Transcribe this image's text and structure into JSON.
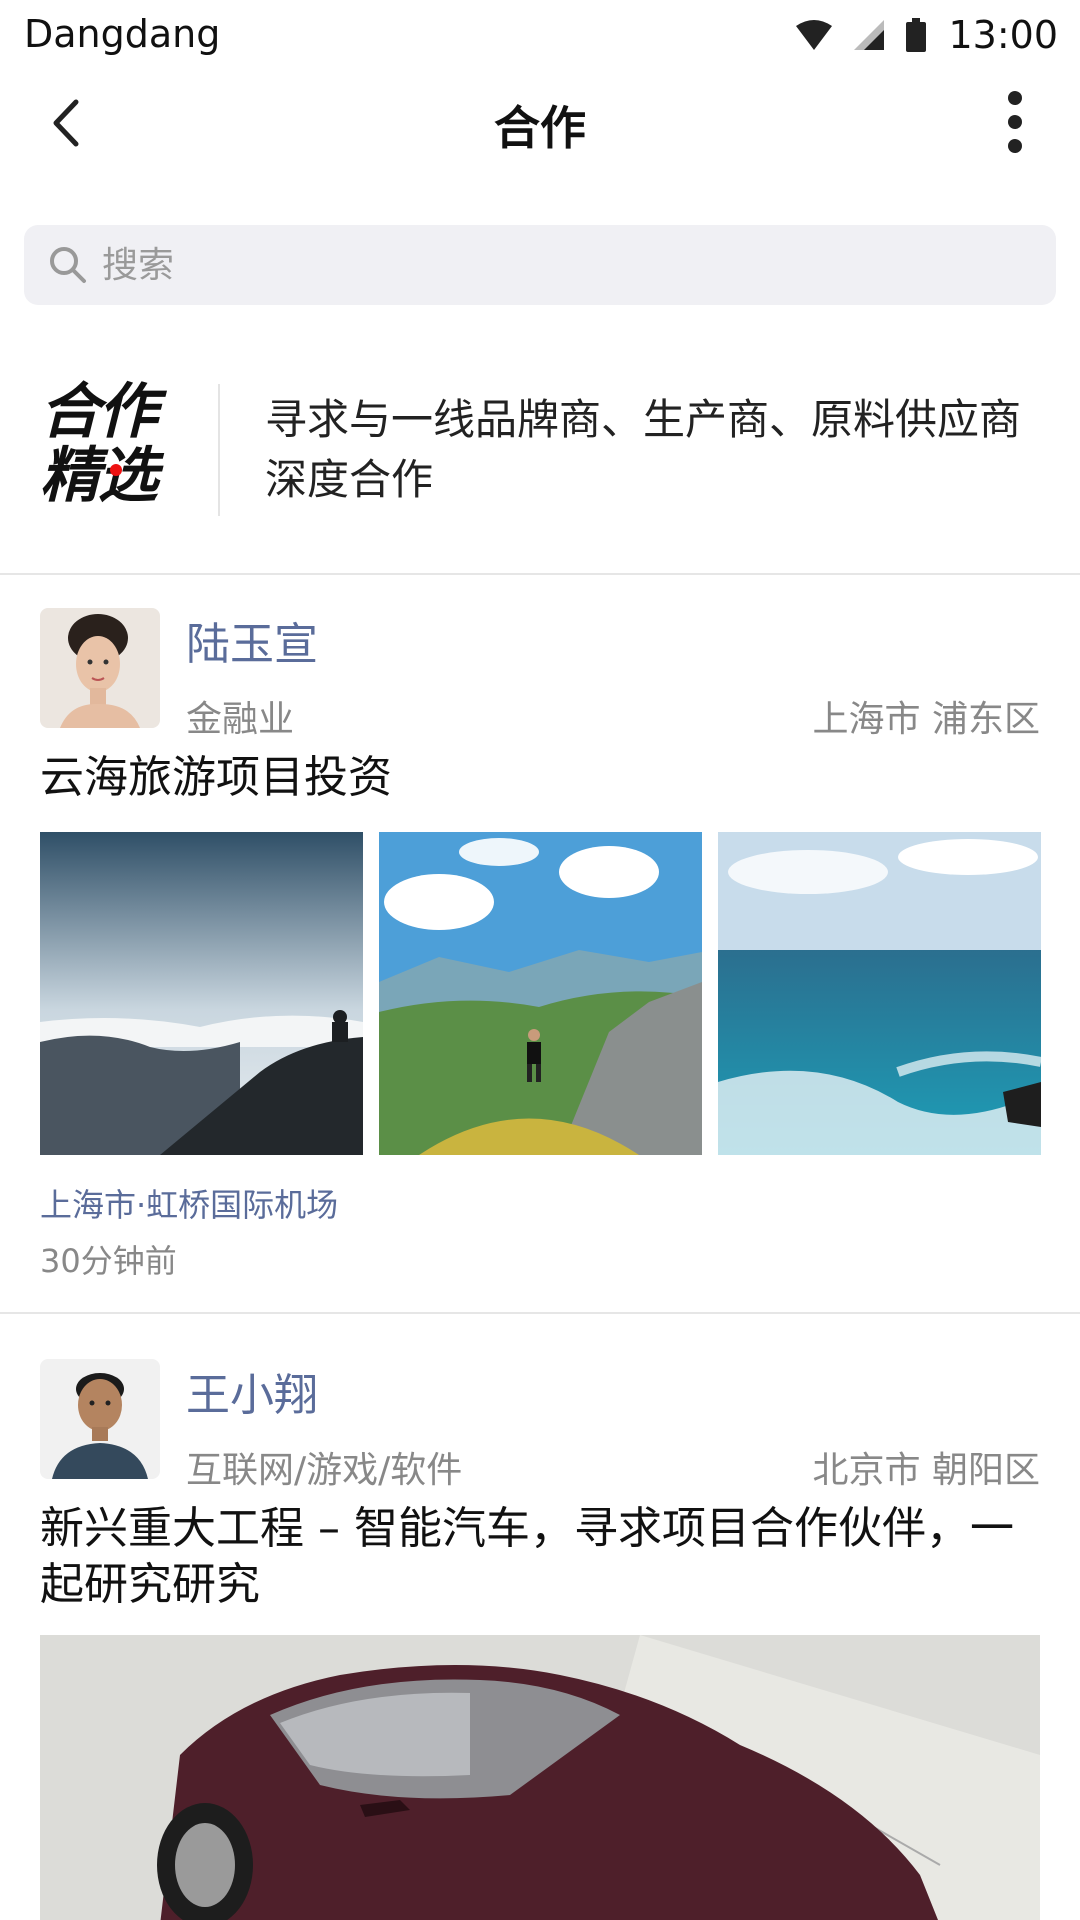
{
  "status_bar": {
    "carrier": "Dangdang",
    "time": "13:00",
    "icons": [
      "wifi-icon",
      "signal-icon",
      "battery-icon"
    ]
  },
  "nav": {
    "title": "合作",
    "back_icon": "chevron-left-icon",
    "more_icon": "more-vertical-icon"
  },
  "search": {
    "placeholder": "搜索",
    "icon": "search-icon"
  },
  "banner": {
    "logo_line1": "合作",
    "logo_line2": "精选",
    "description": "寻求与一线品牌商、生产商、原料供应商深度合作"
  },
  "posts": [
    {
      "name": "陆玉宣",
      "industry": "金融业",
      "location": "上海市 浦东区",
      "title": "云海旅游项目投资",
      "photos": [
        "sea-of-clouds-photo",
        "mountain-hiker-photo",
        "ocean-waves-photo"
      ],
      "place": "上海市·虹桥国际机场",
      "time": "30分钟前"
    },
    {
      "name": "王小翔",
      "industry": "互联网/游戏/软件",
      "location": "北京市 朝阳区",
      "title": "新兴重大工程 – 智能汽车，寻求项目合作伙伴，一起研究研究",
      "photos": [
        "concept-car-photo"
      ]
    }
  ],
  "colors": {
    "accent_name": "#5a6c9a",
    "secondary_text": "#888888",
    "search_bg": "#f0f0f4",
    "logo_dot": "#ee1111"
  }
}
